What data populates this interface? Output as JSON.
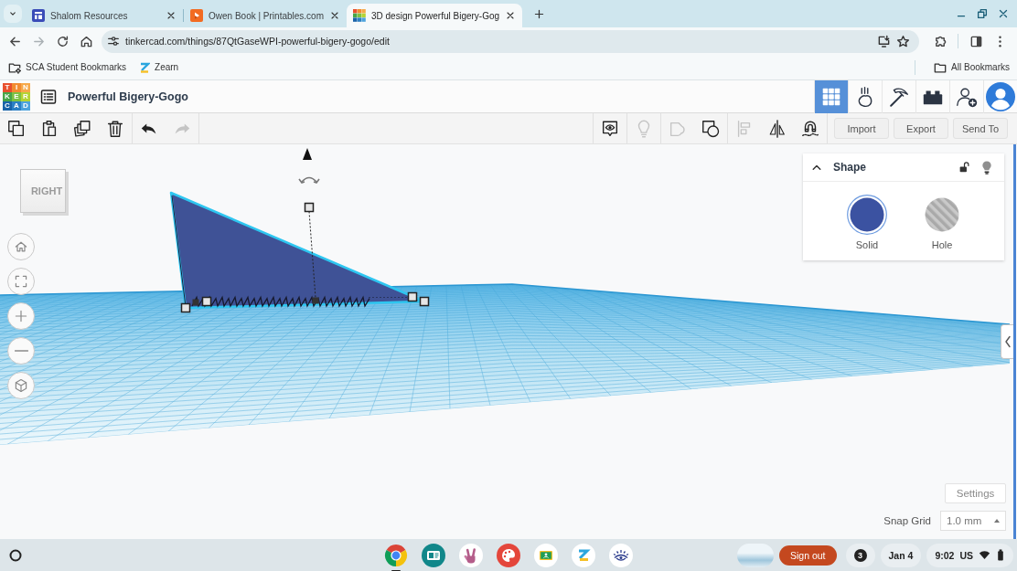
{
  "browser": {
    "tabs": [
      {
        "title": "Shalom Resources",
        "kind": "layout",
        "selected": false
      },
      {
        "title": "Owen Book | Printables.com",
        "kind": "logo",
        "selected": false
      },
      {
        "title": "3D design Powerful Bigery-Gog",
        "kind": "tiles",
        "selected": true
      }
    ],
    "url": "tinkercad.com/things/87QtGaseWPI-powerful-bigery-gogo/edit",
    "bookmarks": [
      {
        "label": "SCA Student Bookmarks",
        "kind": "folder"
      },
      {
        "label": "Zearn",
        "kind": "site"
      }
    ],
    "all_bookmarks": "All Bookmarks"
  },
  "header": {
    "logo": [
      {
        "letter": "T",
        "color": "#e8502e"
      },
      {
        "letter": "I",
        "color": "#f28b30"
      },
      {
        "letter": "N",
        "color": "#f6a94a"
      },
      {
        "letter": "K",
        "color": "#47a547"
      },
      {
        "letter": "E",
        "color": "#7cc142"
      },
      {
        "letter": "R",
        "color": "#b5d334"
      },
      {
        "letter": "C",
        "color": "#1a63a8"
      },
      {
        "letter": "A",
        "color": "#2b7fc4"
      },
      {
        "letter": "D",
        "color": "#4da3dd"
      }
    ],
    "title": "Powerful Bigery-Gogo",
    "modes": [
      {
        "kind": "grid",
        "selected": true
      },
      {
        "kind": "ball",
        "selected": false
      },
      {
        "kind": "pickaxe",
        "selected": false
      },
      {
        "kind": "brick",
        "selected": false
      }
    ]
  },
  "toolbar": {
    "left_groups": [
      {
        "tools": [
          {
            "kind": "copy",
            "disabled": false
          },
          {
            "kind": "paste",
            "disabled": false
          },
          {
            "kind": "duplicate",
            "disabled": false
          },
          {
            "kind": "delete",
            "disabled": false
          }
        ]
      },
      {
        "tools": [
          {
            "kind": "undo",
            "disabled": false
          },
          {
            "kind": "redo",
            "disabled": true
          }
        ]
      }
    ],
    "right_groups": [
      {
        "tools": [
          {
            "kind": "note",
            "disabled": false
          }
        ]
      },
      {
        "tools": [
          {
            "kind": "bulb",
            "disabled": true
          }
        ]
      },
      {
        "tools": [
          {
            "kind": "shape",
            "disabled": true
          },
          {
            "kind": "group",
            "disabled": false
          }
        ]
      },
      {
        "tools": [
          {
            "kind": "align",
            "disabled": true
          },
          {
            "kind": "mirror",
            "disabled": false
          },
          {
            "kind": "magnet",
            "disabled": false
          }
        ]
      }
    ],
    "buttons": [
      "Import",
      "Export",
      "Send To"
    ]
  },
  "shape_panel": {
    "title": "Shape",
    "expanded": true,
    "locked": false,
    "options": [
      {
        "label": "Solid",
        "kind": "solid",
        "selected": true
      },
      {
        "label": "Hole",
        "kind": "hole",
        "selected": false
      }
    ]
  },
  "canvas": {
    "view_cube": "RIGHT",
    "settings": "Settings",
    "snap_grid": {
      "label": "Snap Grid",
      "value": "1.0 mm"
    }
  },
  "shelf": {
    "apps": [
      {
        "kind": "browser",
        "open": true
      },
      {
        "kind": "card",
        "open": false
      },
      {
        "kind": "hand",
        "open": false
      },
      {
        "kind": "palette",
        "open": false
      },
      {
        "kind": "board",
        "open": false
      },
      {
        "kind": "zarrow",
        "open": false
      },
      {
        "kind": "eye",
        "open": false
      }
    ],
    "sign_out": "Sign out",
    "notifications": "3",
    "date": "Jan 4",
    "time": "9:02",
    "input_method": "US"
  }
}
